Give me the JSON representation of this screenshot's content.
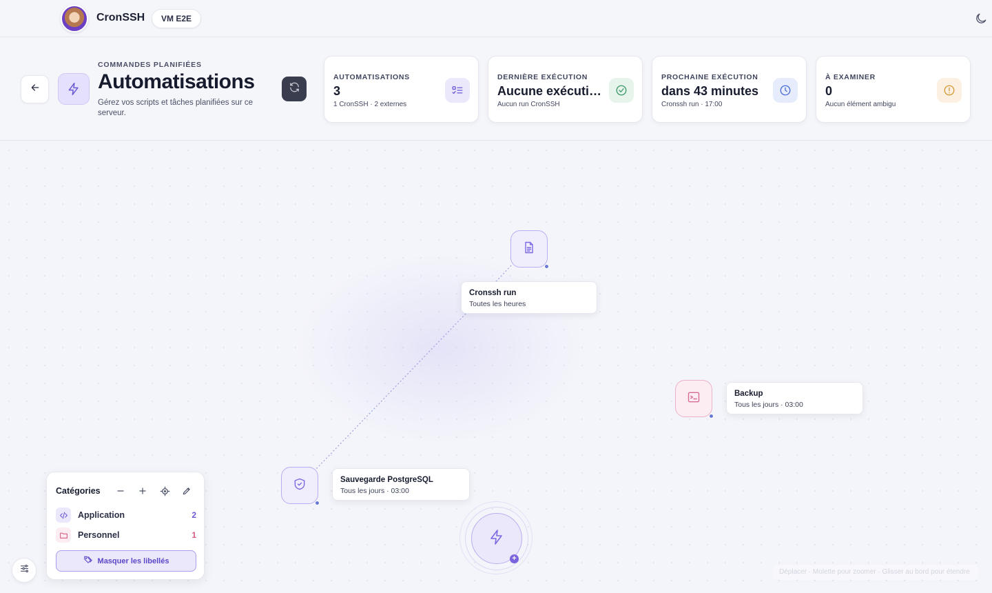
{
  "topbar": {
    "app_name": "CronSSH",
    "vm_badge": "VM E2E",
    "logo_icon": "app-logo-avatar",
    "theme_icon": "moon-icon"
  },
  "header": {
    "eyebrow": "COMMANDES PLANIFIÉES",
    "title": "Automatisations",
    "description": "Gérez vos scripts et tâches planifiées sur ce serveur.",
    "back_icon": "arrow-left-icon",
    "title_icon": "bolt-icon",
    "refresh_icon": "refresh-icon"
  },
  "stats": [
    {
      "label": "AUTOMATISATIONS",
      "value": "3",
      "sub": "1 CronSSH · 2 externes",
      "icon": "list-check-icon",
      "accent": "#6b5ad6",
      "icon_bg": "#ebe8fb"
    },
    {
      "label": "DERNIÈRE EXÉCUTION",
      "value": "Aucune exécution",
      "sub": "Aucun run CronSSH",
      "icon": "check-circle-icon",
      "accent": "#3e9a6a",
      "icon_bg": "#e6f4ec"
    },
    {
      "label": "PROCHAINE EXÉCUTION",
      "value": "dans 43 minutes",
      "sub": "Cronssh run · 17:00",
      "icon": "clock-icon",
      "accent": "#4a6fd8",
      "icon_bg": "#e6ecfb"
    },
    {
      "label": "À EXAMINER",
      "value": "0",
      "sub": "Aucun élément ambigu",
      "icon": "alert-circle-icon",
      "accent": "#d69a3a",
      "icon_bg": "#fbf0e1"
    }
  ],
  "nodes": [
    {
      "title": "Cronssh run",
      "schedule": "Toutes les heures",
      "icon": "file-text-icon",
      "accent": "#7b6ae0"
    },
    {
      "title": "Backup",
      "schedule": "Tous les jours · 03:00",
      "icon": "terminal-icon",
      "accent": "#d66b94"
    },
    {
      "title": "Sauvegarde PostgreSQL",
      "schedule": "Tous les jours · 03:00",
      "icon": "shield-check-icon",
      "accent": "#7b6ae0"
    }
  ],
  "add_button_icon": "bolt-plus-icon",
  "categories": {
    "title": "Catégories",
    "tools": [
      "minus-icon",
      "plus-icon",
      "target-icon",
      "pencil-icon"
    ],
    "items": [
      {
        "label": "Application",
        "count": "2",
        "icon": "code-icon",
        "color": "#6b5ad6"
      },
      {
        "label": "Personnel",
        "count": "1",
        "icon": "folder-icon",
        "color": "#d65a86"
      }
    ],
    "mask_button": "Masquer les libellés",
    "mask_icon": "tags-icon"
  },
  "settings_icon": "sliders-icon",
  "hints": "Déplacer · Molette pour zoomer · Glisser au bord pour étendre"
}
